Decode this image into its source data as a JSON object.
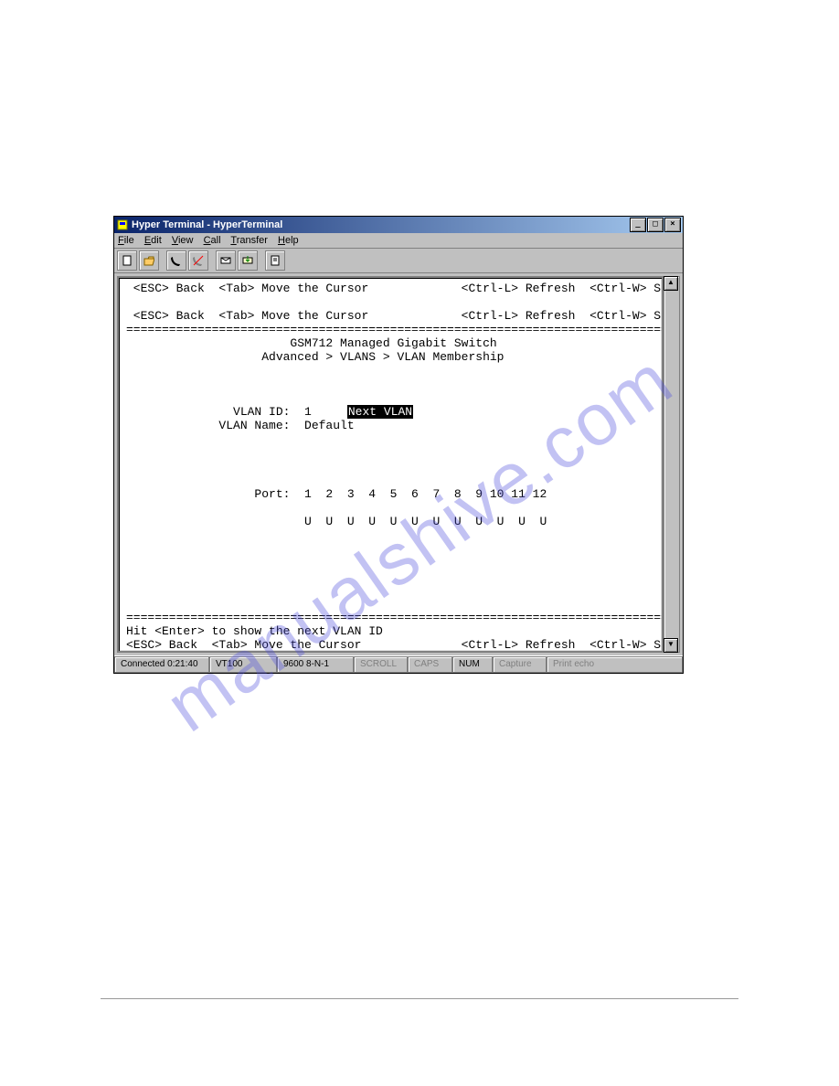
{
  "window": {
    "title": "Hyper Terminal - HyperTerminal"
  },
  "menu": {
    "file": "File",
    "edit": "Edit",
    "view": "View",
    "call": "Call",
    "transfer": "Transfer",
    "help": "Help"
  },
  "terminal": {
    "line_top1": " <ESC> Back  <Tab> Move the Cursor             <Ctrl-L> Refresh  <Ctrl-W> Save",
    "line_top2": " <ESC> Back  <Tab> Move the Cursor             <Ctrl-L> Refresh  <Ctrl-W> Save",
    "divider_top": "==============================================================================",
    "title_line": "                       GSM712 Managed Gigabit Switch",
    "breadcrumb": "                   Advanced > VLANS > VLAN Membership",
    "vlan_id_label": "               VLAN ID:  1     ",
    "next_vlan": "Next VLAN",
    "vlan_name_line": "             VLAN Name:  Default",
    "port_header": "                  Port:  1  2  3  4  5  6  7  8  9 10 11 12",
    "port_values": "                         U  U  U  U  U  U  U  U  U  U  U  U",
    "divider_bot": "==============================================================================",
    "hint_line": "Hit <Enter> to show the next VLAN ID",
    "bottom_nav": "<ESC> Back  <Tab> Move the Cursor              <Ctrl-L> Refresh  <Ctrl-W> Save"
  },
  "status": {
    "connected": "Connected 0:21:40",
    "emu": "VT100",
    "settings": "9600 8-N-1",
    "scroll": "SCROLL",
    "caps": "CAPS",
    "num": "NUM",
    "capture": "Capture",
    "printecho": "Print echo"
  },
  "watermark": "manualshive.com"
}
